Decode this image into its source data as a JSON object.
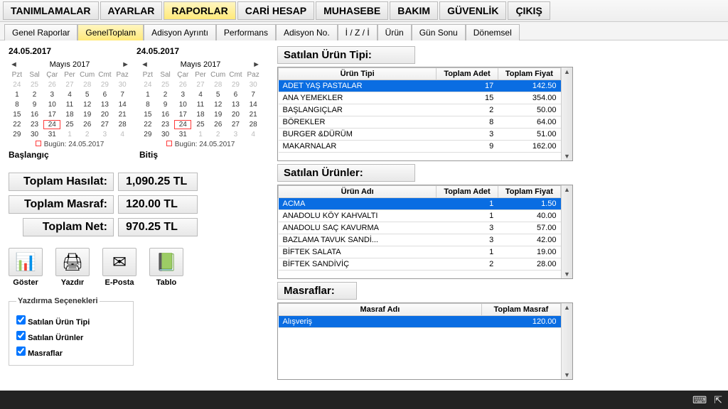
{
  "menu": {
    "items": [
      "TANIMLAMALAR",
      "AYARLAR",
      "RAPORLAR",
      "CARİ HESAP",
      "MUHASEBE",
      "BAKIM",
      "GÜVENLİK",
      "ÇIKIŞ"
    ],
    "active": 2
  },
  "tabs": {
    "items": [
      "Genel Raporlar",
      "GenelToplam",
      "Adisyon Ayrıntı",
      "Performans",
      "Adisyon No.",
      "İ / Z / İ",
      "Ürün",
      "Gün Sonu",
      "Dönemsel"
    ],
    "active": 1
  },
  "dates": {
    "start_label": "24.05.2017",
    "end_label": "24.05.2017",
    "start_caption": "Başlangıç",
    "end_caption": "Bitiş"
  },
  "cal": {
    "title": "Mayıs 2017",
    "today": "Bugün: 24.05.2017",
    "days_hdr": [
      "Pzt",
      "Sal",
      "Çar",
      "Per",
      "Cum",
      "Cmt",
      "Paz"
    ],
    "cells": [
      {
        "v": "24",
        "g": 1
      },
      {
        "v": "25",
        "g": 1
      },
      {
        "v": "26",
        "g": 1
      },
      {
        "v": "27",
        "g": 1
      },
      {
        "v": "28",
        "g": 1
      },
      {
        "v": "29",
        "g": 1
      },
      {
        "v": "30",
        "g": 1
      },
      {
        "v": "1"
      },
      {
        "v": "2"
      },
      {
        "v": "3"
      },
      {
        "v": "4"
      },
      {
        "v": "5"
      },
      {
        "v": "6"
      },
      {
        "v": "7"
      },
      {
        "v": "8"
      },
      {
        "v": "9"
      },
      {
        "v": "10"
      },
      {
        "v": "11"
      },
      {
        "v": "12"
      },
      {
        "v": "13"
      },
      {
        "v": "14"
      },
      {
        "v": "15"
      },
      {
        "v": "16"
      },
      {
        "v": "17"
      },
      {
        "v": "18"
      },
      {
        "v": "19"
      },
      {
        "v": "20"
      },
      {
        "v": "21"
      },
      {
        "v": "22"
      },
      {
        "v": "23"
      },
      {
        "v": "24",
        "sel": 1
      },
      {
        "v": "25"
      },
      {
        "v": "26"
      },
      {
        "v": "27"
      },
      {
        "v": "28"
      },
      {
        "v": "29"
      },
      {
        "v": "30"
      },
      {
        "v": "31"
      },
      {
        "v": "1",
        "g": 1
      },
      {
        "v": "2",
        "g": 1
      },
      {
        "v": "3",
        "g": 1
      },
      {
        "v": "4",
        "g": 1
      }
    ]
  },
  "totals": {
    "hasilat_label": "Toplam Hasılat:",
    "hasilat_value": "1,090.25 TL",
    "masraf_label": "Toplam Masraf:",
    "masraf_value": "120.00 TL",
    "net_label": "Toplam Net:",
    "net_value": "970.25 TL"
  },
  "actions": {
    "goster": {
      "label": "Göster",
      "icon": "📊"
    },
    "yazdir": {
      "label": "Yazdır",
      "icon": "🖨"
    },
    "eposta": {
      "label": "E-Posta",
      "icon": "✉"
    },
    "tablo": {
      "label": "Tablo",
      "icon": "📗"
    }
  },
  "print_opts": {
    "legend": "Yazdırma Seçenekleri",
    "items": [
      "Satılan Ürün Tipi",
      "Satılan Ürünler",
      "Masraflar"
    ]
  },
  "grid1": {
    "title": "Satılan Ürün Tipi:",
    "cols": [
      "Ürün Tipi",
      "Toplam Adet",
      "Toplam Fiyat"
    ],
    "rows": [
      {
        "name": "ADET YAŞ PASTALAR",
        "qty": "17",
        "price": "142.50",
        "sel": 1
      },
      {
        "name": "ANA YEMEKLER",
        "qty": "15",
        "price": "354.00"
      },
      {
        "name": "BAŞLANGIÇLAR",
        "qty": "2",
        "price": "50.00"
      },
      {
        "name": "BÖREKLER",
        "qty": "8",
        "price": "64.00"
      },
      {
        "name": "BURGER &DÜRÜM",
        "qty": "3",
        "price": "51.00"
      },
      {
        "name": "MAKARNALAR",
        "qty": "9",
        "price": "162.00"
      }
    ]
  },
  "grid2": {
    "title": "Satılan Ürünler:",
    "cols": [
      "Ürün Adı",
      "Toplam Adet",
      "Toplam Fiyat"
    ],
    "rows": [
      {
        "name": "ACMA",
        "qty": "1",
        "price": "1.50",
        "sel": 1
      },
      {
        "name": "ANADOLU KÖY KAHVALTI",
        "qty": "1",
        "price": "40.00"
      },
      {
        "name": "ANADOLU SAÇ KAVURMA",
        "qty": "3",
        "price": "57.00"
      },
      {
        "name": "BAZLAMA TAVUK SANDİ...",
        "qty": "3",
        "price": "42.00"
      },
      {
        "name": "BİFTEK SALATA",
        "qty": "1",
        "price": "19.00"
      },
      {
        "name": "BİFTEK SANDİVİÇ",
        "qty": "2",
        "price": "28.00"
      }
    ]
  },
  "grid3": {
    "title": "Masraflar:",
    "cols": [
      "Masraf Adı",
      "Toplam Masraf"
    ],
    "rows": [
      {
        "name": "Alışveriş",
        "price": "120.00",
        "sel": 1
      }
    ]
  }
}
